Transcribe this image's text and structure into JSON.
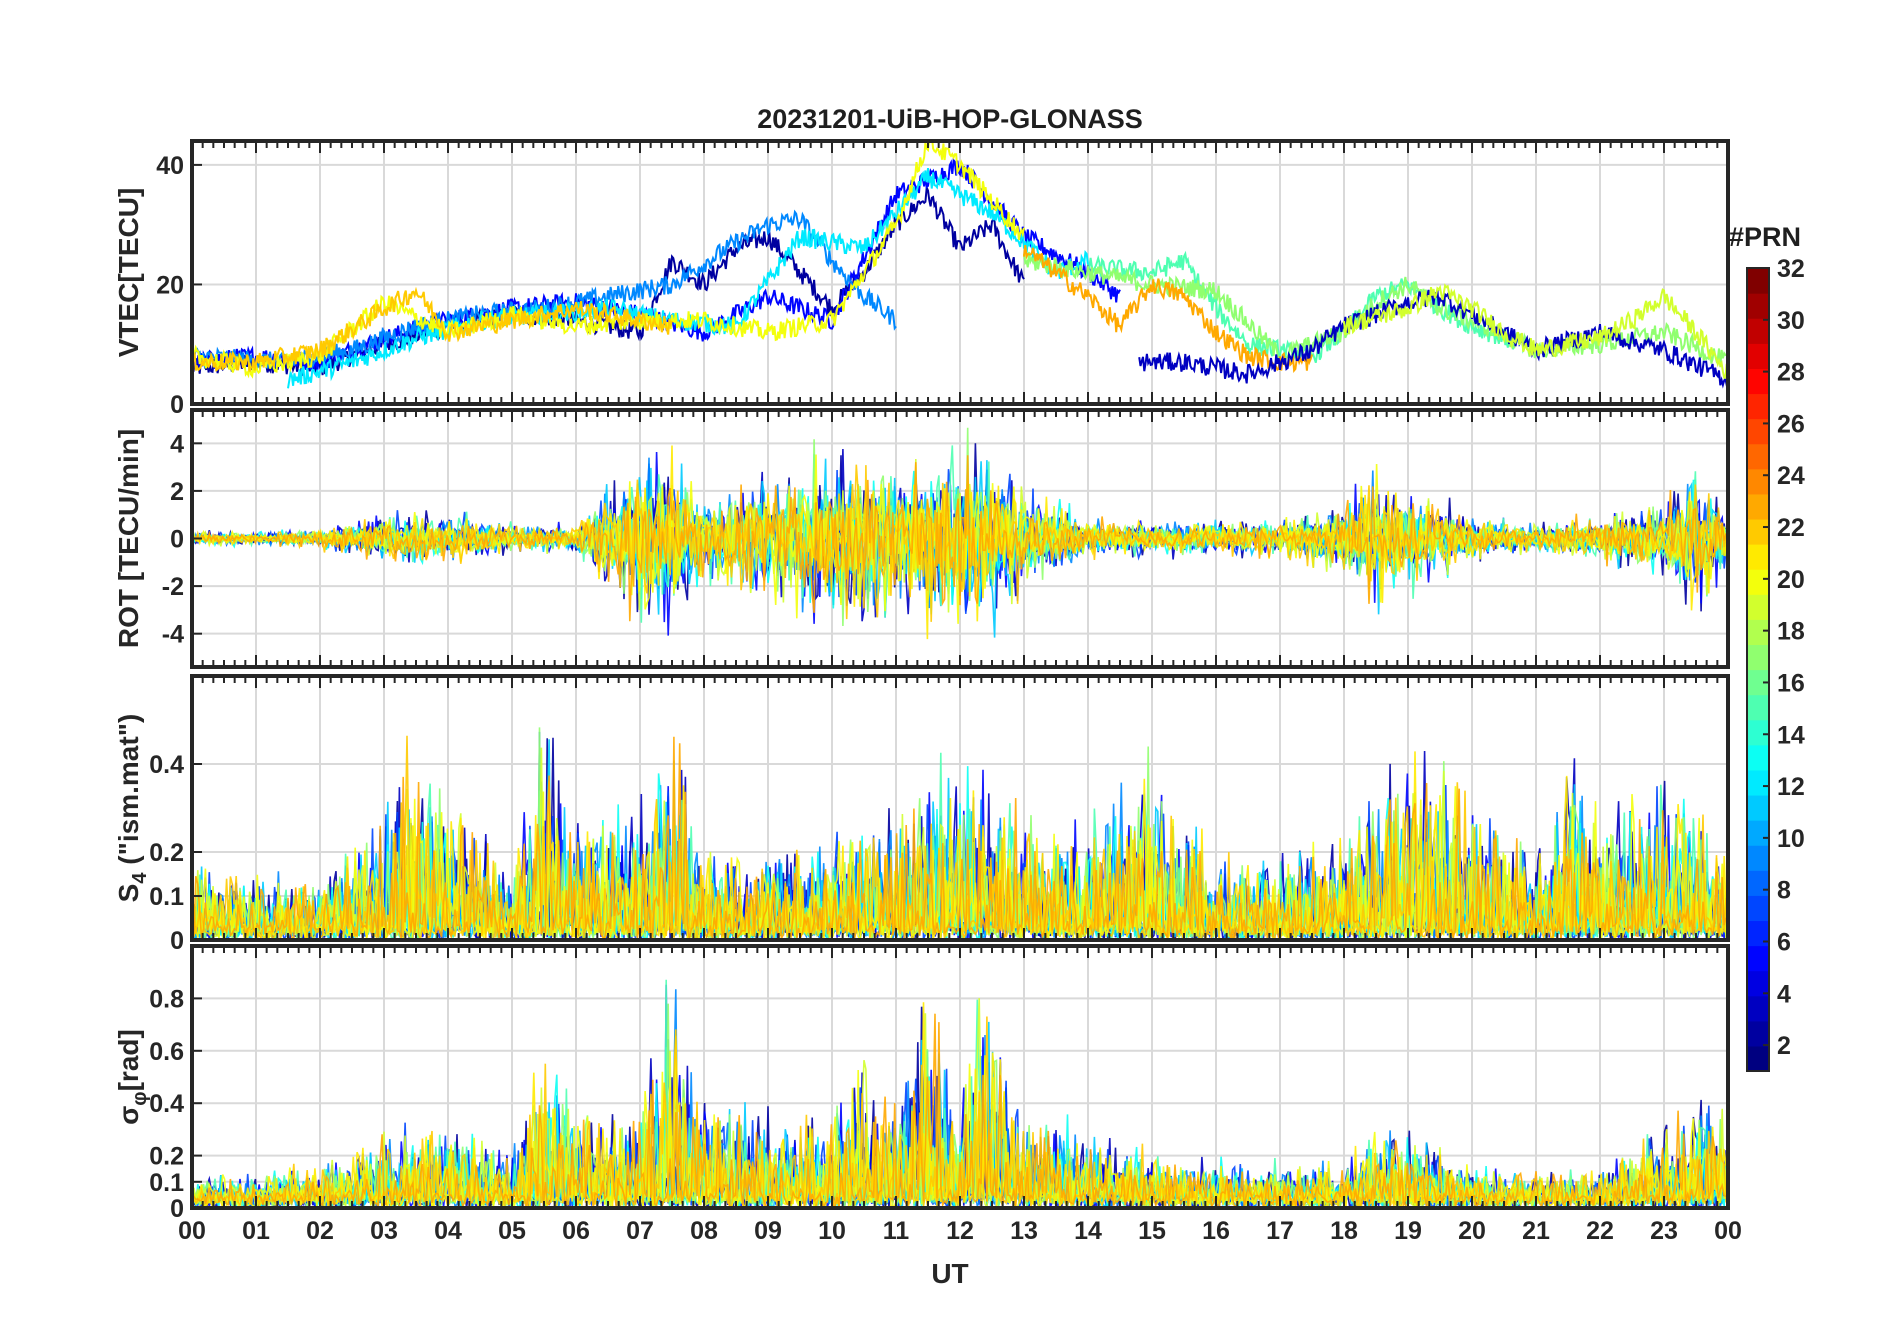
{
  "chart_data": {
    "type": "line",
    "title": "20231201-UiB-HOP-GLONASS",
    "xlabel": "UT",
    "xlim": [
      0,
      24
    ],
    "xticks": [
      "00",
      "01",
      "02",
      "03",
      "04",
      "05",
      "06",
      "07",
      "08",
      "09",
      "10",
      "11",
      "12",
      "13",
      "14",
      "15",
      "16",
      "17",
      "18",
      "19",
      "20",
      "21",
      "22",
      "23",
      "00"
    ],
    "grid": true,
    "colorbar": {
      "title": "#PRN",
      "range": [
        1,
        32
      ],
      "ticks": [
        2,
        4,
        6,
        8,
        10,
        12,
        14,
        16,
        18,
        20,
        22,
        24,
        26,
        28,
        30,
        32
      ],
      "colormap": "jet",
      "levels": 32
    },
    "panels": [
      {
        "id": "vtec",
        "ylabel": "VTEC[TECU]",
        "ylim": [
          0,
          44
        ],
        "yticks": [
          0,
          20,
          40
        ],
        "series": [
          {
            "prn": 2,
            "x": [
              0,
              1,
              2,
              3,
              4,
              5,
              6,
              7,
              7.5,
              8,
              8.5,
              9,
              10,
              10.5,
              11,
              11.5,
              12,
              12.5,
              13
            ],
            "y": [
              6,
              7,
              6,
              10,
              13,
              15,
              14,
              12,
              24,
              20,
              26,
              28,
              16,
              22,
              30,
              35,
              26,
              30,
              20
            ]
          },
          {
            "prn": 5,
            "x": [
              0,
              1,
              2,
              3,
              4,
              5,
              6,
              7,
              8,
              9,
              10,
              11,
              12,
              13,
              14,
              14.5
            ],
            "y": [
              7,
              8,
              7,
              11,
              14,
              16,
              17,
              15,
              12,
              18,
              14,
              35,
              40,
              28,
              22,
              18
            ]
          },
          {
            "prn": 9,
            "x": [
              0,
              1.5,
              2.5,
              3.5,
              4.5,
              5.5,
              6.5,
              7.5,
              8.5,
              9,
              9.5,
              10,
              10.5,
              11
            ],
            "y": [
              8,
              7,
              9,
              13,
              15,
              16,
              18,
              20,
              27,
              30,
              31,
              24,
              18,
              14
            ]
          },
          {
            "prn": 12,
            "x": [
              1.5,
              2.5,
              3.5,
              4.5,
              5.5,
              6.5,
              7.5,
              8.5,
              9.5,
              10.5,
              11.5,
              12.5,
              13.5,
              14
            ],
            "y": [
              4,
              7,
              11,
              14,
              15,
              16,
              14,
              13,
              28,
              26,
              38,
              32,
              22,
              24
            ]
          },
          {
            "prn": 15,
            "x": [
              14,
              15,
              15.5,
              16,
              16.5,
              17,
              17.5,
              18,
              18.5,
              19,
              19.5,
              20,
              20.5,
              21
            ],
            "y": [
              23,
              22,
              24,
              16,
              10,
              9,
              8,
              12,
              18,
              20,
              16,
              13,
              11,
              9
            ]
          },
          {
            "prn": 17,
            "x": [
              13,
              14,
              15,
              16,
              17,
              18,
              18.5,
              19,
              19.5,
              20,
              21,
              22,
              23,
              24
            ],
            "y": [
              24,
              22,
              20,
              19,
              8,
              12,
              17,
              20,
              16,
              14,
              9,
              10,
              12,
              7
            ]
          },
          {
            "prn": 20,
            "x": [
              0,
              1,
              2,
              3,
              4,
              5,
              6,
              7,
              8,
              9,
              10,
              11,
              11.5,
              12,
              12.5,
              13
            ],
            "y": [
              8,
              6,
              8,
              17,
              12,
              15,
              13,
              14,
              14,
              12,
              14,
              30,
              44,
              40,
              34,
              28
            ]
          },
          {
            "prn": 22,
            "x": [
              0,
              1,
              2,
              3,
              3.5,
              4,
              5,
              6,
              6.5,
              7,
              7.5
            ],
            "y": [
              7,
              7,
              9,
              16,
              19,
              12,
              14,
              16,
              15,
              14,
              13
            ]
          },
          {
            "prn": 23,
            "x": [
              13,
              14,
              14.5,
              15,
              15.5,
              16,
              16.5,
              17,
              17.5
            ],
            "y": [
              26,
              18,
              13,
              20,
              18,
              12,
              8,
              7,
              7
            ]
          },
          {
            "prn": 3,
            "x": [
              14.8,
              15.5,
              16,
              16.5,
              17,
              17.5,
              18,
              18.5,
              19,
              19.5,
              20,
              21,
              22,
              23,
              24
            ],
            "y": [
              7,
              7,
              6,
              5,
              7,
              9,
              13,
              15,
              17,
              18,
              15,
              9,
              12,
              9,
              4
            ]
          },
          {
            "prn": 19,
            "x": [
              18,
              19,
              19.5,
              20,
              20.5,
              21,
              22,
              22.5,
              23,
              23.5,
              24
            ],
            "y": [
              13,
              16,
              19,
              16,
              12,
              9,
              11,
              14,
              18,
              12,
              5
            ]
          }
        ]
      },
      {
        "id": "rot",
        "ylabel": "ROT [TECU/min]",
        "ylim": [
          -5.4,
          5.4
        ],
        "yticks": [
          -4,
          -2,
          0,
          2,
          4
        ],
        "activity_profile": {
          "hours": [
            0,
            1,
            2,
            3,
            4,
            5,
            6,
            7,
            7.5,
            8,
            9,
            10,
            10.5,
            11,
            11.5,
            12,
            12.5,
            13,
            14,
            15,
            16,
            17,
            18,
            18.5,
            19,
            20,
            21,
            22,
            23,
            23.5,
            24
          ],
          "amplitude": [
            0.4,
            0.4,
            0.6,
            1.5,
            1.5,
            0.8,
            0.8,
            5,
            5,
            2.5,
            3.5,
            5,
            5,
            5,
            5,
            5,
            5,
            3,
            1.2,
            1,
            1,
            1.2,
            2,
            4,
            3,
            1.2,
            0.8,
            1.3,
            2,
            4.5,
            1.5
          ]
        }
      },
      {
        "id": "s4",
        "ylabel": "S4 (\"ism.mat\")",
        "ylabel_main": "S",
        "ylabel_sub": "4",
        "ylabel_rest": " (\"ism.mat\")",
        "ylim": [
          0,
          0.6
        ],
        "yticks": [
          0,
          0.1,
          0.2,
          0.4
        ],
        "activity_profile": {
          "hours": [
            0,
            1,
            2,
            3,
            3.3,
            4,
            4.5,
            5,
            5.5,
            6,
            7,
            7.5,
            8,
            9,
            10,
            11,
            12,
            13,
            14,
            14.8,
            15.5,
            16,
            17,
            18,
            19,
            19.5,
            20,
            21,
            21.5,
            22,
            23,
            24
          ],
          "amplitude": [
            0.18,
            0.15,
            0.14,
            0.3,
            0.5,
            0.35,
            0.3,
            0.15,
            0.55,
            0.3,
            0.3,
            0.55,
            0.2,
            0.2,
            0.25,
            0.3,
            0.45,
            0.3,
            0.25,
            0.45,
            0.3,
            0.2,
            0.2,
            0.25,
            0.5,
            0.45,
            0.35,
            0.2,
            0.5,
            0.3,
            0.4,
            0.2
          ]
        }
      },
      {
        "id": "sigma_phi",
        "ylabel": "σφ[rad]",
        "ylabel_main": "σ",
        "ylabel_sub": "φ",
        "ylabel_rest": "[rad]",
        "ylim": [
          0,
          1
        ],
        "yticks": [
          0,
          0.1,
          0.2,
          0.4,
          0.6,
          0.8
        ],
        "activity_profile": {
          "hours": [
            0,
            1,
            2,
            3,
            4,
            5,
            5.5,
            6,
            7,
            7.5,
            8,
            9,
            10,
            10.5,
            11,
            11.5,
            12,
            12.3,
            13,
            14,
            15,
            16,
            17,
            18,
            18.5,
            19,
            20,
            21,
            22,
            23,
            23.8,
            24
          ],
          "amplitude": [
            0.1,
            0.1,
            0.15,
            0.3,
            0.35,
            0.2,
            0.7,
            0.4,
            0.4,
            1.0,
            0.45,
            0.35,
            0.35,
            0.65,
            0.35,
            1.0,
            0.35,
            1.0,
            0.35,
            0.3,
            0.2,
            0.15,
            0.15,
            0.15,
            0.35,
            0.3,
            0.15,
            0.12,
            0.12,
            0.35,
            0.5,
            0.3
          ]
        }
      }
    ]
  }
}
